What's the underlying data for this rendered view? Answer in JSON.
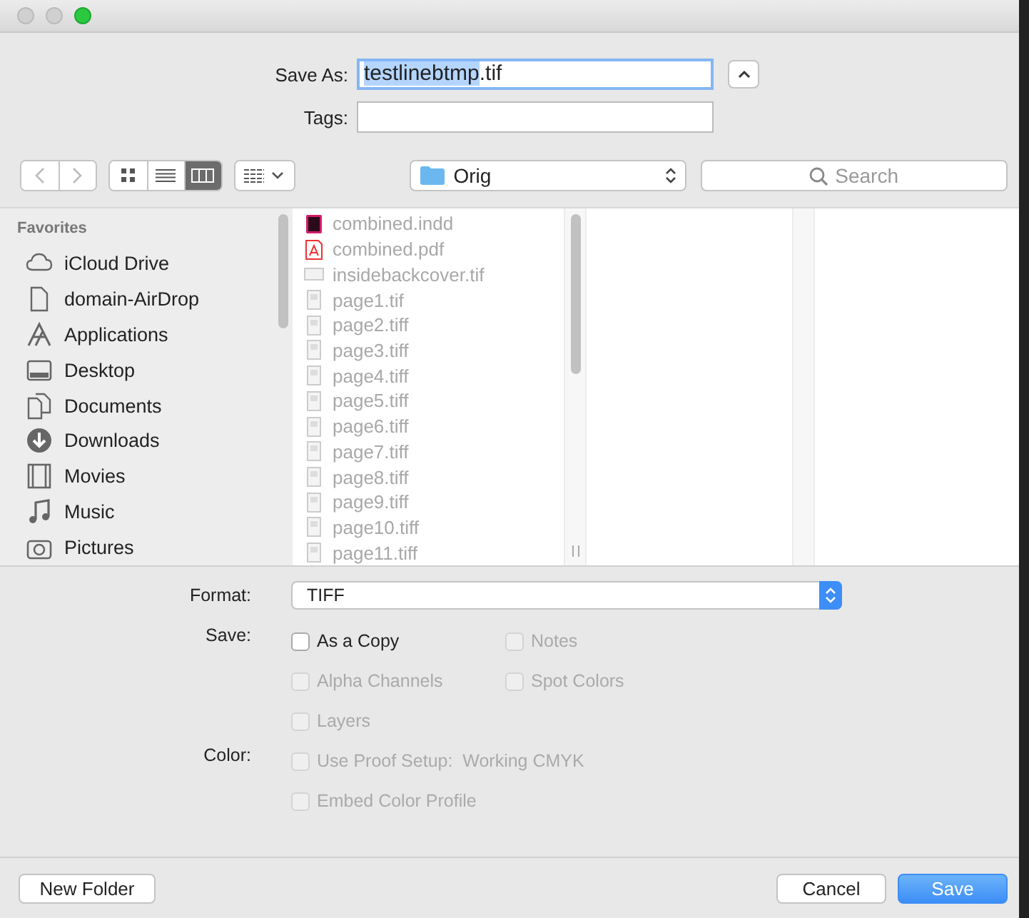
{
  "save_as": {
    "label": "Save As:",
    "value_selected": "testlinebtmp",
    "value_rest": ".tif"
  },
  "tags": {
    "label": "Tags:"
  },
  "location": {
    "name": "Orig"
  },
  "search": {
    "placeholder": "Search"
  },
  "sidebar": {
    "heading": "Favorites",
    "items": [
      {
        "label": "iCloud Drive",
        "kind": "cloud"
      },
      {
        "label": "domain-AirDrop",
        "kind": "document"
      },
      {
        "label": "Applications",
        "kind": "apps"
      },
      {
        "label": "Desktop",
        "kind": "desktop"
      },
      {
        "label": "Documents",
        "kind": "documents"
      },
      {
        "label": "Downloads",
        "kind": "download"
      },
      {
        "label": "Movies",
        "kind": "film"
      },
      {
        "label": "Music",
        "kind": "music"
      },
      {
        "label": "Pictures",
        "kind": "camera"
      }
    ]
  },
  "files": [
    {
      "name": "combined.indd",
      "kind": "indd",
      "disabled": true
    },
    {
      "name": "combined.pdf",
      "kind": "pdf",
      "disabled": true
    },
    {
      "name": "insidebackcover.tif",
      "kind": "wide",
      "disabled": true
    },
    {
      "name": "page1.tif",
      "kind": "page",
      "disabled": true
    },
    {
      "name": "page2.tiff",
      "kind": "page",
      "disabled": true
    },
    {
      "name": "page3.tiff",
      "kind": "page",
      "disabled": true
    },
    {
      "name": "page4.tiff",
      "kind": "page",
      "disabled": true
    },
    {
      "name": "page5.tiff",
      "kind": "page",
      "disabled": true
    },
    {
      "name": "page6.tiff",
      "kind": "page",
      "disabled": true
    },
    {
      "name": "page7.tiff",
      "kind": "page",
      "disabled": true
    },
    {
      "name": "page8.tiff",
      "kind": "page",
      "disabled": true
    },
    {
      "name": "page9.tiff",
      "kind": "page",
      "disabled": true
    },
    {
      "name": "page10.tiff",
      "kind": "page",
      "disabled": true
    },
    {
      "name": "page11.tiff",
      "kind": "page",
      "disabled": true
    }
  ],
  "format": {
    "label": "Format:",
    "value": "TIFF"
  },
  "option_groups": [
    {
      "label": "Save:",
      "rows": [
        [
          {
            "label": "As a Copy",
            "checked": false,
            "disabled": false
          },
          {
            "label": "Notes",
            "checked": false,
            "disabled": true
          }
        ],
        [
          {
            "label": "Alpha Channels",
            "checked": false,
            "disabled": true
          },
          {
            "label": "Spot Colors",
            "checked": false,
            "disabled": true
          }
        ],
        [
          {
            "label": "Layers",
            "checked": false,
            "disabled": true
          }
        ]
      ]
    },
    {
      "label": "Color:",
      "rows": [
        [
          {
            "label": "Use Proof Setup:  Working CMYK",
            "checked": false,
            "disabled": true
          }
        ],
        [
          {
            "label": "Embed Color Profile",
            "checked": false,
            "disabled": true
          }
        ]
      ]
    }
  ],
  "buttons": {
    "new_folder": "New Folder",
    "cancel": "Cancel",
    "save": "Save"
  }
}
